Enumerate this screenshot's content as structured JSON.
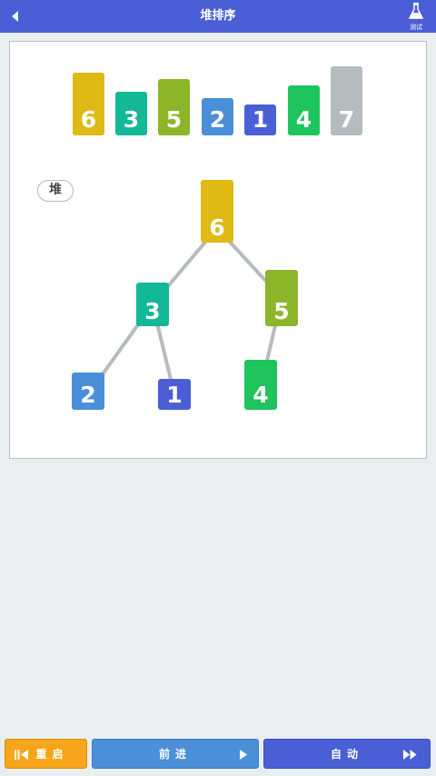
{
  "header": {
    "title": "堆排序",
    "test_label": "测试"
  },
  "array": {
    "items": [
      {
        "value": "6",
        "color": "#dfb914"
      },
      {
        "value": "3",
        "color": "#13b896"
      },
      {
        "value": "5",
        "color": "#8cb52a"
      },
      {
        "value": "2",
        "color": "#4a8fd8"
      },
      {
        "value": "1",
        "color": "#4a5fd6"
      },
      {
        "value": "4",
        "color": "#1ec45c"
      },
      {
        "value": "7",
        "color": "#b4bcc0"
      }
    ]
  },
  "heap": {
    "label": "堆",
    "nodes": [
      {
        "value": "6",
        "color": "#dfb914"
      },
      {
        "value": "3",
        "color": "#13b896"
      },
      {
        "value": "5",
        "color": "#8cb52a"
      },
      {
        "value": "2",
        "color": "#4a8fd8"
      },
      {
        "value": "1",
        "color": "#4a5fd6"
      },
      {
        "value": "4",
        "color": "#1ec45c"
      }
    ],
    "edge_color": "#b4bcc0"
  },
  "controls": {
    "restart_label": "重启",
    "forward_label": "前进",
    "auto_label": "自动"
  }
}
